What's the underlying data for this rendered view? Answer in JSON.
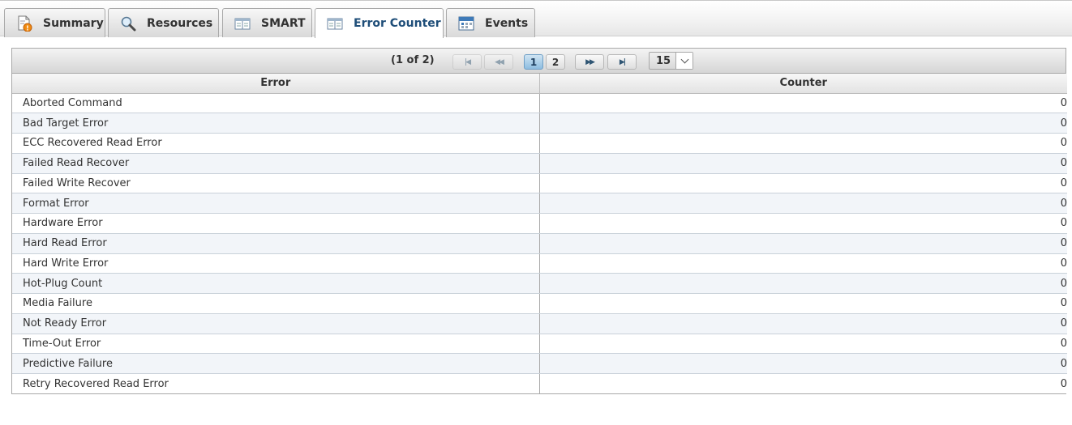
{
  "tabs": [
    {
      "label": "Summary",
      "icon": "summary-warning-icon"
    },
    {
      "label": "Resources",
      "icon": "magnifier-icon"
    },
    {
      "label": "SMART",
      "icon": "table-icon"
    },
    {
      "label": "Error Counter",
      "icon": "table-icon",
      "active": true
    },
    {
      "label": "Events",
      "icon": "calendar-icon"
    }
  ],
  "paginator": {
    "report": "(1 of 2)",
    "pages": [
      "1",
      "2"
    ],
    "current_page": "1",
    "rows_per_page": "15"
  },
  "table": {
    "columns": [
      "Error",
      "Counter"
    ],
    "rows": [
      {
        "error": "Aborted Command",
        "counter": "0"
      },
      {
        "error": "Bad Target Error",
        "counter": "0"
      },
      {
        "error": "ECC Recovered Read Error",
        "counter": "0"
      },
      {
        "error": "Failed Read Recover",
        "counter": "0"
      },
      {
        "error": "Failed Write Recover",
        "counter": "0"
      },
      {
        "error": "Format Error",
        "counter": "0"
      },
      {
        "error": "Hardware Error",
        "counter": "0"
      },
      {
        "error": "Hard Read Error",
        "counter": "0"
      },
      {
        "error": "Hard Write Error",
        "counter": "0"
      },
      {
        "error": "Hot-Plug Count",
        "counter": "0"
      },
      {
        "error": "Media Failure",
        "counter": "0"
      },
      {
        "error": "Not Ready Error",
        "counter": "0"
      },
      {
        "error": "Time-Out Error",
        "counter": "0"
      },
      {
        "error": "Predictive Failure",
        "counter": "0"
      },
      {
        "error": "Retry Recovered Read Error",
        "counter": "0"
      }
    ]
  },
  "colors": {
    "active_tab_text": "#1f4e79",
    "current_page": "#8ebde0",
    "row_alt": "#f2f5f9"
  }
}
